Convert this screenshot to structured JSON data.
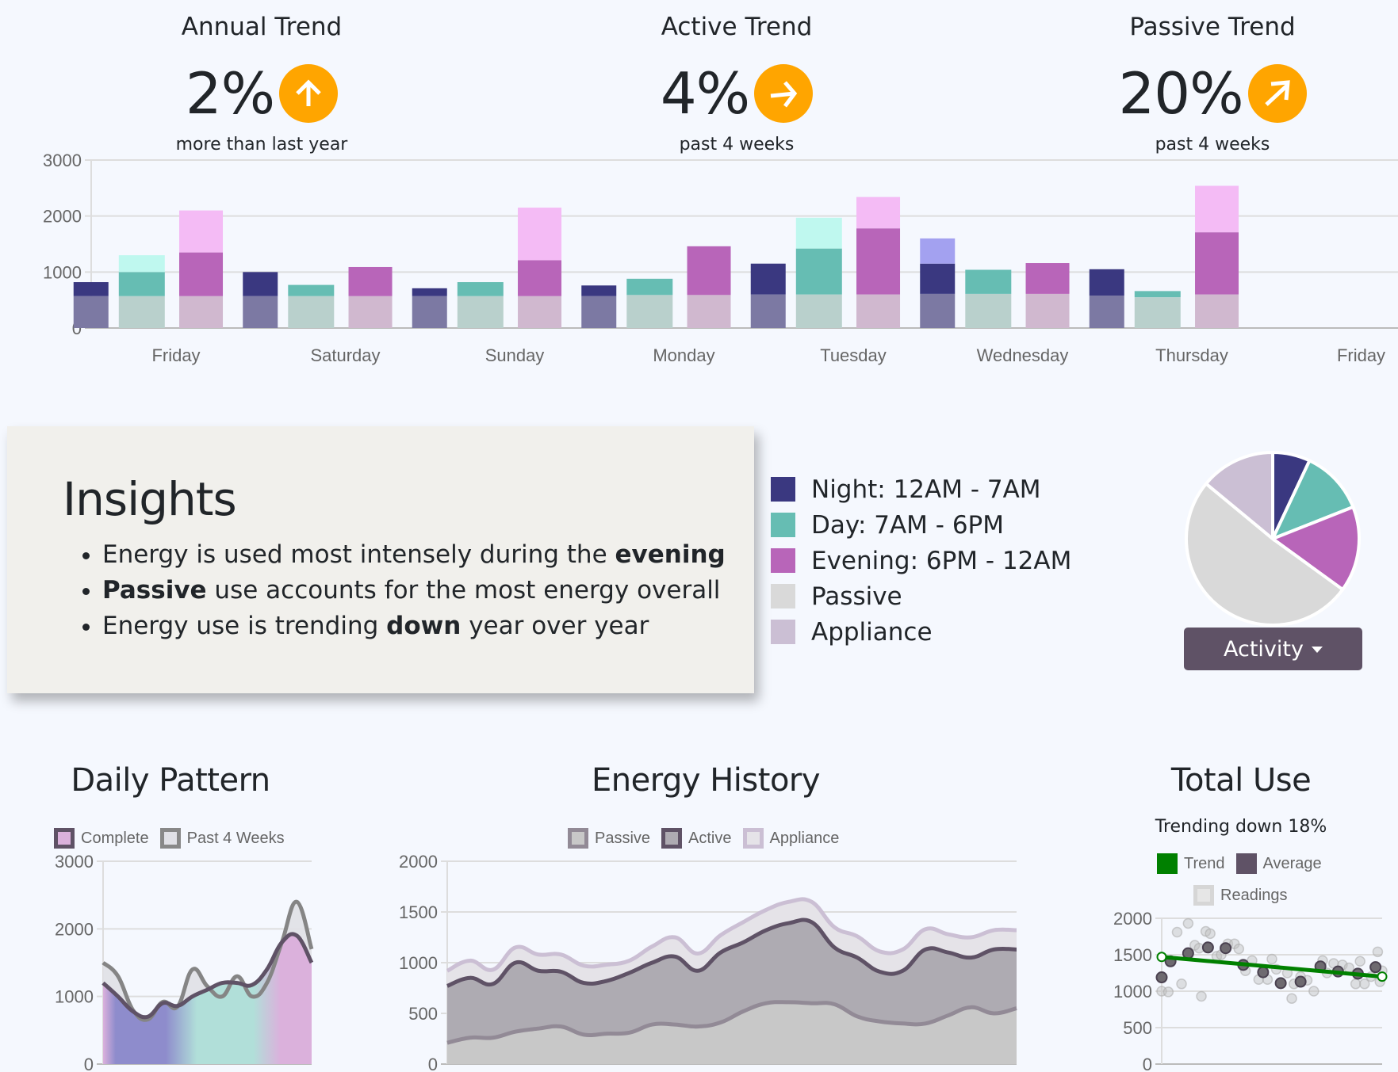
{
  "trends": [
    {
      "title": "Annual Trend",
      "value": "2%",
      "subtitle": "more than last year",
      "icon": "arrow-up-icon"
    },
    {
      "title": "Active Trend",
      "value": "4%",
      "subtitle": "past 4 weeks",
      "icon": "arrow-right-icon"
    },
    {
      "title": "Passive Trend",
      "value": "20%",
      "subtitle": "past 4 weeks",
      "icon": "arrow-up-right-icon"
    }
  ],
  "colors": {
    "accent": "#ffa500",
    "night": "#3a3880",
    "day": "#66bdb3",
    "evening": "#b865b9",
    "passive": "#d9d9d9",
    "appliance": "#cbbfd4",
    "button": "#5f5266",
    "trend_green": "#008000"
  },
  "insights": {
    "title": "Insights",
    "items": [
      {
        "before": "Energy is used most intensely during the ",
        "bold": "evening",
        "after": ""
      },
      {
        "before": "",
        "bold": "Passive",
        "after": " use accounts for the most energy overall"
      },
      {
        "before": "Energy use is trending ",
        "bold": "down",
        "after": " year over year"
      }
    ]
  },
  "legend": [
    {
      "label": "Night: 12AM - 7AM",
      "color": "#3a3880"
    },
    {
      "label": "Day: 7AM - 6PM",
      "color": "#66bdb3"
    },
    {
      "label": "Evening: 6PM - 12AM",
      "color": "#b865b9"
    },
    {
      "label": "Passive",
      "color": "#d9d9d9"
    },
    {
      "label": "Appliance",
      "color": "#cbbfd4"
    }
  ],
  "activity_button": {
    "label": "Activity"
  },
  "sections": {
    "daily": "Daily Pattern",
    "history": "Energy History",
    "total": "Total Use",
    "total_subtitle": "Trending down 18%"
  },
  "chart_data": [
    {
      "id": "weekly-bars",
      "type": "bar",
      "title": "",
      "categories": [
        "Friday",
        "Saturday",
        "Sunday",
        "Monday",
        "Tuesday",
        "Wednesday",
        "Thursday",
        "Friday"
      ],
      "ylim": [
        0,
        3000
      ],
      "yticks": [
        0,
        1000,
        2000,
        3000
      ],
      "grid": true,
      "bars": [
        {
          "slot": 0.5,
          "type": "night",
          "base": 570,
          "value": 820,
          "extra": 0
        },
        {
          "slot": 0.8,
          "type": "day",
          "base": 570,
          "value": 1000,
          "extra": 300
        },
        {
          "slot": 1.15,
          "type": "evening",
          "base": 570,
          "value": 1350,
          "extra": 750
        },
        {
          "slot": 1.5,
          "type": "night",
          "base": 570,
          "value": 1000,
          "extra": 0
        },
        {
          "slot": 1.8,
          "type": "day",
          "base": 570,
          "value": 770,
          "extra": 0
        },
        {
          "slot": 2.15,
          "type": "evening",
          "base": 570,
          "value": 1090,
          "extra": 0
        },
        {
          "slot": 2.5,
          "type": "night",
          "base": 570,
          "value": 710,
          "extra": 0
        },
        {
          "slot": 2.8,
          "type": "day",
          "base": 570,
          "value": 820,
          "extra": 0
        },
        {
          "slot": 3.15,
          "type": "evening",
          "base": 570,
          "value": 1210,
          "extra": 940
        },
        {
          "slot": 3.5,
          "type": "night",
          "base": 570,
          "value": 760,
          "extra": 0
        },
        {
          "slot": 3.8,
          "type": "day",
          "base": 590,
          "value": 880,
          "extra": 0
        },
        {
          "slot": 4.15,
          "type": "evening",
          "base": 590,
          "value": 1460,
          "extra": 0
        },
        {
          "slot": 4.5,
          "type": "night",
          "base": 600,
          "value": 1150,
          "extra": 0
        },
        {
          "slot": 4.8,
          "type": "day",
          "base": 600,
          "value": 1420,
          "extra": 550
        },
        {
          "slot": 5.15,
          "type": "evening",
          "base": 600,
          "value": 1780,
          "extra": 560
        },
        {
          "slot": 5.5,
          "type": "night",
          "base": 610,
          "value": 1150,
          "extra": 450
        },
        {
          "slot": 5.8,
          "type": "day",
          "base": 610,
          "value": 1040,
          "extra": 0
        },
        {
          "slot": 6.15,
          "type": "evening",
          "base": 610,
          "value": 1160,
          "extra": 0
        },
        {
          "slot": 6.5,
          "type": "night",
          "base": 580,
          "value": 1050,
          "extra": 0
        },
        {
          "slot": 6.8,
          "type": "day",
          "base": 550,
          "value": 660,
          "extra": 0
        },
        {
          "slot": 7.15,
          "type": "evening",
          "base": 600,
          "value": 1710,
          "extra": 830
        }
      ]
    },
    {
      "id": "activity-pie",
      "type": "pie",
      "labels": [
        "Night",
        "Day",
        "Evening",
        "Passive",
        "Appliance"
      ],
      "values": [
        7,
        12,
        16,
        51,
        14
      ]
    },
    {
      "id": "daily-pattern",
      "type": "area",
      "title": "Daily Pattern",
      "legend": [
        "Complete",
        "Past 4 Weeks"
      ],
      "ylim": [
        0,
        3000
      ],
      "yticks": [
        0,
        1000,
        2000,
        3000
      ],
      "series": [
        {
          "name": "Complete",
          "values": [
            1200,
            1000,
            780,
            700,
            900,
            860,
            1000,
            1100,
            1200,
            1200,
            1170,
            1400,
            1800,
            1900,
            1500
          ]
        },
        {
          "name": "Past 4 Weeks",
          "values": [
            1500,
            1300,
            800,
            660,
            920,
            850,
            1400,
            1150,
            1000,
            1300,
            1000,
            1200,
            1800,
            2400,
            1700
          ]
        }
      ]
    },
    {
      "id": "energy-history",
      "type": "area",
      "title": "Energy History",
      "legend": [
        "Passive",
        "Active",
        "Appliance"
      ],
      "ylim": [
        0,
        2000
      ],
      "yticks": [
        0,
        500,
        1000,
        1500,
        2000
      ],
      "series": [
        {
          "name": "Passive",
          "values": [
            210,
            260,
            260,
            320,
            350,
            370,
            290,
            300,
            310,
            390,
            390,
            370,
            410,
            520,
            600,
            610,
            600,
            590,
            470,
            420,
            400,
            400,
            480,
            560,
            500,
            550
          ]
        },
        {
          "name": "Active",
          "values": [
            770,
            850,
            790,
            1000,
            920,
            910,
            800,
            820,
            900,
            1000,
            1060,
            920,
            1100,
            1200,
            1320,
            1390,
            1400,
            1150,
            1050,
            910,
            920,
            1130,
            1100,
            1050,
            1130,
            1130
          ]
        },
        {
          "name": "Appliance",
          "values": [
            920,
            1020,
            930,
            1150,
            1080,
            1080,
            970,
            980,
            1020,
            1160,
            1250,
            1090,
            1270,
            1400,
            1520,
            1600,
            1600,
            1350,
            1260,
            1110,
            1130,
            1330,
            1280,
            1250,
            1320,
            1320
          ]
        }
      ]
    },
    {
      "id": "total-use",
      "type": "scatter",
      "title": "Total Use",
      "subtitle": "Trending down 18%",
      "legend": [
        "Trend",
        "Average",
        "Readings"
      ],
      "ylim": [
        0,
        2000
      ],
      "yticks": [
        0,
        500,
        1000,
        1500,
        2000
      ],
      "trend": [
        [
          0,
          1470
        ],
        [
          1,
          1200
        ]
      ],
      "average": [
        [
          0,
          1190
        ],
        [
          0.04,
          1410
        ],
        [
          0.12,
          1520
        ],
        [
          0.21,
          1600
        ],
        [
          0.29,
          1590
        ],
        [
          0.37,
          1360
        ],
        [
          0.46,
          1260
        ],
        [
          0.54,
          1110
        ],
        [
          0.63,
          1130
        ],
        [
          0.72,
          1340
        ],
        [
          0.8,
          1270
        ],
        [
          0.89,
          1240
        ],
        [
          0.97,
          1330
        ]
      ],
      "readings": [
        [
          0,
          1000
        ],
        [
          0.03,
          990
        ],
        [
          0.07,
          1810
        ],
        [
          0.09,
          1100
        ],
        [
          0.12,
          1930
        ],
        [
          0.15,
          1630
        ],
        [
          0.17,
          1590
        ],
        [
          0.18,
          930
        ],
        [
          0.2,
          1820
        ],
        [
          0.22,
          1790
        ],
        [
          0.25,
          1480
        ],
        [
          0.27,
          1500
        ],
        [
          0.3,
          1650
        ],
        [
          0.33,
          1650
        ],
        [
          0.35,
          1580
        ],
        [
          0.38,
          1280
        ],
        [
          0.41,
          1420
        ],
        [
          0.44,
          1160
        ],
        [
          0.48,
          1160
        ],
        [
          0.5,
          1440
        ],
        [
          0.52,
          1300
        ],
        [
          0.57,
          1250
        ],
        [
          0.59,
          900
        ],
        [
          0.6,
          1100
        ],
        [
          0.63,
          1200
        ],
        [
          0.66,
          1150
        ],
        [
          0.69,
          1000
        ],
        [
          0.73,
          1420
        ],
        [
          0.75,
          1250
        ],
        [
          0.78,
          1380
        ],
        [
          0.82,
          1360
        ],
        [
          0.85,
          1320
        ],
        [
          0.88,
          1100
        ],
        [
          0.9,
          1410
        ],
        [
          0.92,
          1100
        ],
        [
          0.95,
          1200
        ],
        [
          0.98,
          1540
        ],
        [
          1,
          1280
        ],
        [
          0.99,
          1130
        ]
      ]
    }
  ]
}
